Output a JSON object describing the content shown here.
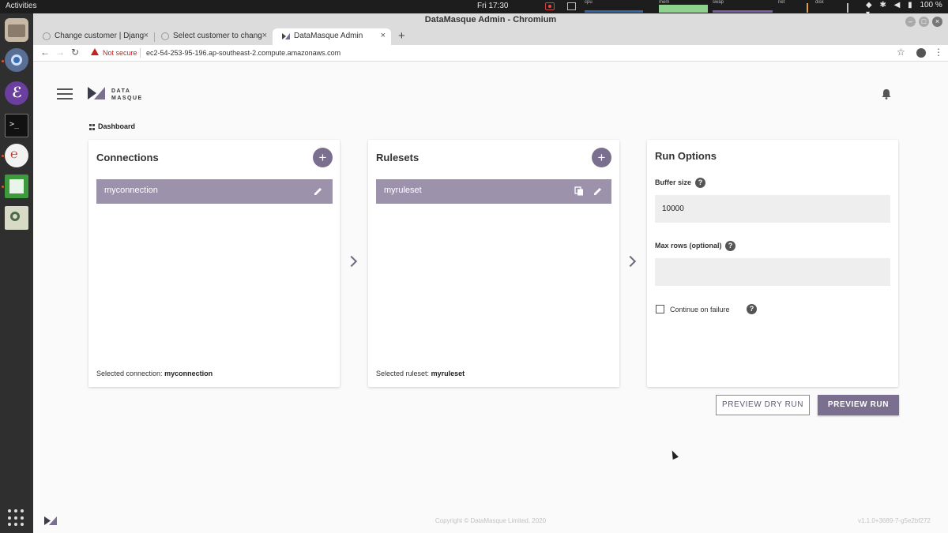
{
  "system": {
    "activities": "Activities",
    "clock": "Fri 17:30",
    "monitors": {
      "cpu": "cpu",
      "mem": "mem",
      "swap": "swap",
      "net": "net",
      "disk": "disk"
    },
    "battery": "100 %",
    "dropdown": "▾"
  },
  "browser": {
    "window_title": "DataMasque Admin - Chromium",
    "tabs": [
      {
        "label": "Change customer | Djang"
      },
      {
        "label": "Select customer to chang"
      },
      {
        "label": "DataMasque Admin"
      }
    ],
    "new_tab": "+",
    "security_label": "Not secure",
    "url": "ec2-54-253-95-196.ap-southeast-2.compute.amazonaws.com"
  },
  "app": {
    "logo_line1": "DATA",
    "logo_line2": "MASQUE",
    "breadcrumb": "Dashboard",
    "connections": {
      "title": "Connections",
      "add": "+",
      "items": [
        {
          "label": "myconnection"
        }
      ],
      "selected_prefix": "Selected connection:",
      "selected_value": "myconnection"
    },
    "rulesets": {
      "title": "Rulesets",
      "add": "+",
      "items": [
        {
          "label": "myruleset"
        }
      ],
      "selected_prefix": "Selected ruleset:",
      "selected_value": "myruleset"
    },
    "run_options": {
      "title": "Run Options",
      "buffer_size_label": "Buffer size",
      "buffer_size_value": "10000",
      "max_rows_label": "Max rows (optional)",
      "max_rows_value": "",
      "continue_label": "Continue on failure",
      "help_glyph": "?"
    },
    "buttons": {
      "preview_dry_run": "PREVIEW DRY RUN",
      "preview_run": "PREVIEW RUN"
    },
    "footer": {
      "copyright": "Copyright © DataMasque Limited, 2020",
      "version": "v1.1.0+3689-7-g5e2bf272"
    }
  },
  "colors": {
    "accent": "#7b6f90",
    "list_selected": "#9d92ac",
    "input_bg": "#eeeeee",
    "dock_bg": "#2f2f2f"
  }
}
